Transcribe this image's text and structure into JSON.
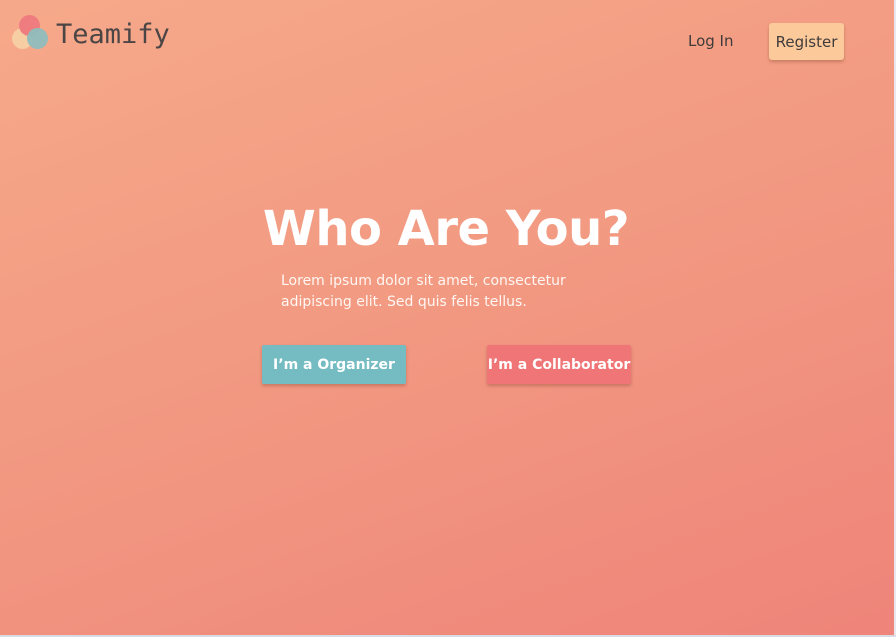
{
  "brand": {
    "name": "Teamify",
    "logo_colors": [
      "#ef7d7f",
      "#f7cfa5",
      "#8fbcbd"
    ]
  },
  "nav": {
    "login_label": "Log In",
    "register_label": "Register"
  },
  "hero": {
    "title": "Who Are You?",
    "description": "Lorem ipsum dolor sit amet, consectetur adipiscing elit. Sed quis felis tellus.",
    "organizer_button": "I’m a Organizer",
    "collaborator_button": "I’m a Collaborator"
  },
  "colors": {
    "background_start": "#f6a98a",
    "background_end": "#ef847a",
    "organizer": "#74bcc2",
    "collaborator": "#ef7577",
    "register": "#fbc99a"
  }
}
